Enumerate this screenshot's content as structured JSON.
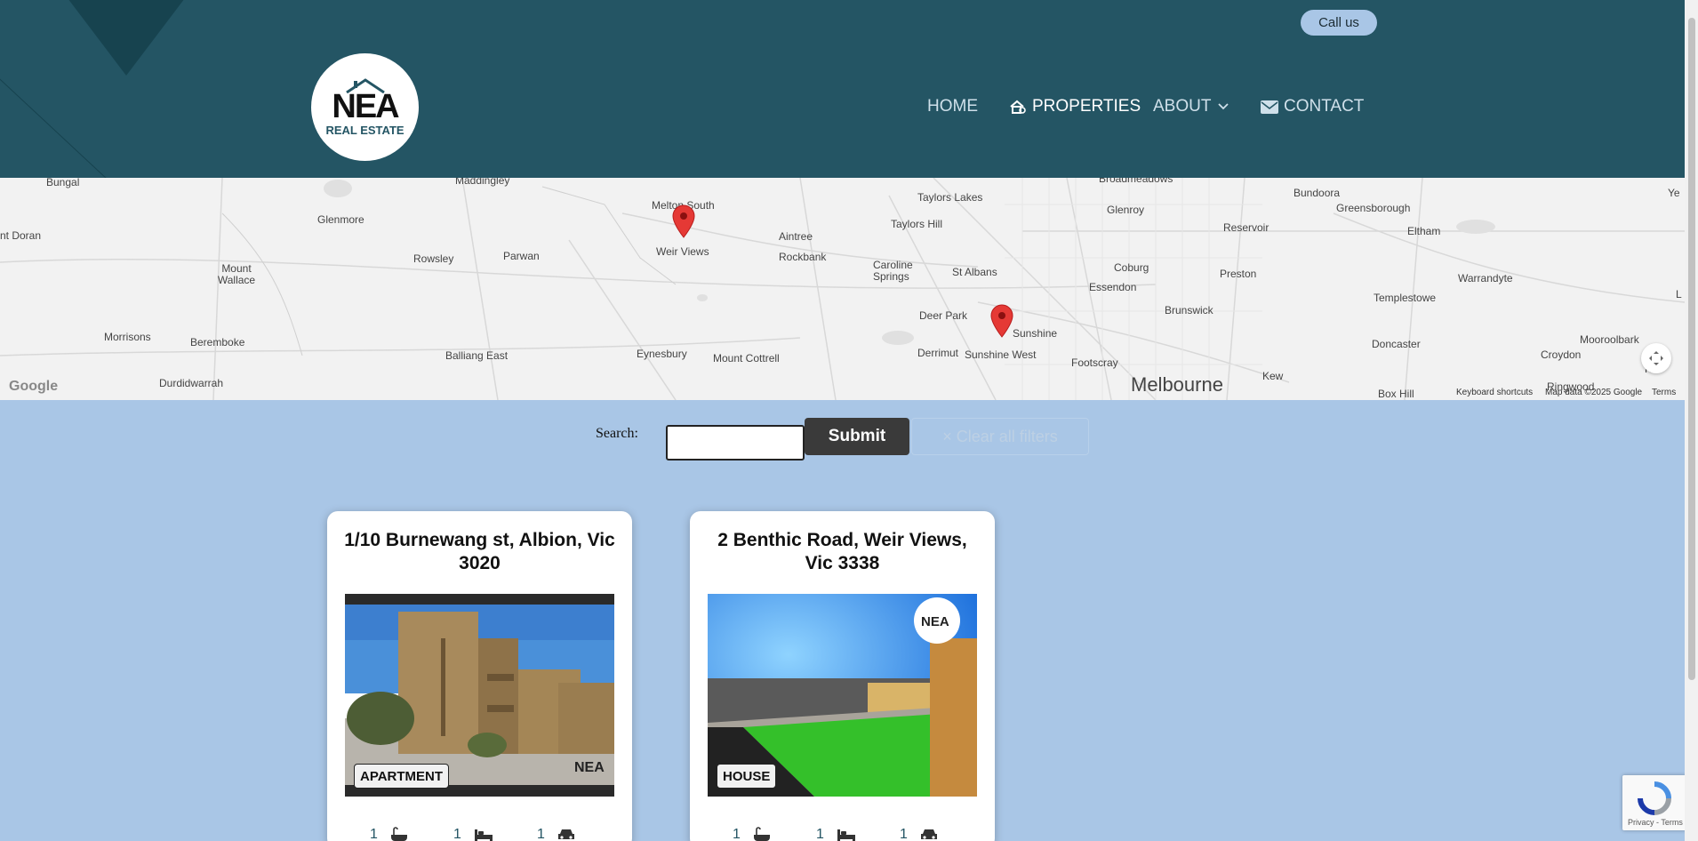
{
  "header": {
    "call_us": "Call us",
    "logo": {
      "mark": "NEA",
      "sub": "REAL ESTATE"
    },
    "nav": [
      {
        "label": "HOME"
      },
      {
        "label": "PROPERTIES",
        "icon": "house-search-icon"
      },
      {
        "label": "ABOUT",
        "icon": "chevron-down-icon"
      },
      {
        "label": "CONTACT",
        "icon": "envelope-icon"
      }
    ]
  },
  "map": {
    "places": [
      "Bungal",
      "Maddingley",
      "Melton South",
      "Weir Views",
      "Aintree",
      "Rockbank",
      "Taylors Lakes",
      "Taylors Hill",
      "Caroline Springs",
      "St Albans",
      "Glenroy",
      "Broadmeadows",
      "Bundoora",
      "Greensborough",
      "Reservoir",
      "Eltham",
      "Coburg",
      "Preston",
      "Essendon",
      "Warrandyte",
      "Templestowe",
      "Brunswick",
      "Deer Park",
      "Sunshine",
      "Sunshine West",
      "Derrimut",
      "Footscray",
      "Doncaster",
      "Mooroolbark",
      "Croydon",
      "Kew",
      "Box Hill",
      "Melbourne",
      "Glenmore",
      "Rowsley",
      "Parwan",
      "Mount Wallace",
      "Morrisons",
      "Beremboke",
      "Balliang East",
      "Eynesbury",
      "Mount Cottrell",
      "Durdidwarrah",
      "nt Doran",
      "Ye",
      "L",
      "Kils",
      "Ringwood"
    ],
    "attribution": {
      "shortcuts": "Keyboard shortcuts",
      "data": "Map data ©2025 Google",
      "terms": "Terms"
    },
    "google": "Google"
  },
  "search": {
    "label": "Search:",
    "value": "",
    "submit": "Submit",
    "clear": "× Clear all filters"
  },
  "cards": [
    {
      "title": "1/10 Burnewang st, Albion, Vic 3020",
      "type": "APARTMENT",
      "baths": "1",
      "beds": "1",
      "cars": "1"
    },
    {
      "title": "2 Benthic Road, Weir Views, Vic 3338",
      "type": "HOUSE",
      "baths": "1",
      "beds": "1",
      "cars": "1"
    }
  ],
  "recaptcha": {
    "text": "Privacy - Terms"
  },
  "colors": {
    "header": "#245564",
    "page": "#a9c6e6",
    "pin": "#e53935",
    "button": "#3a3a3a"
  }
}
